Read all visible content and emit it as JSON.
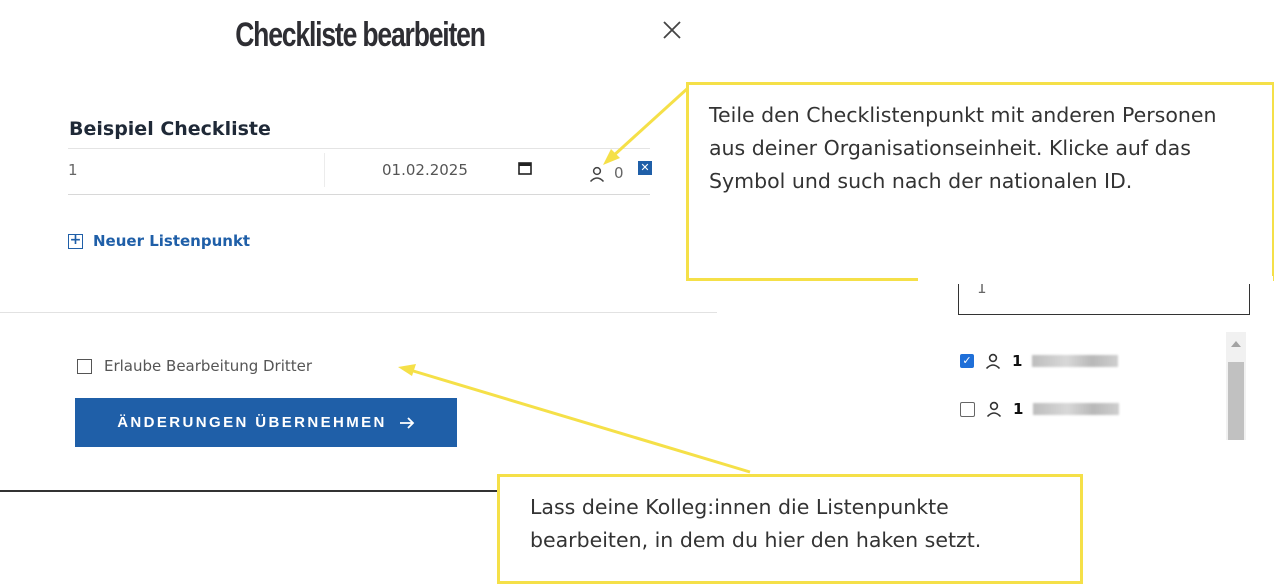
{
  "dialog": {
    "title": "Checkliste bearbeiten",
    "checklist_title": "Beispiel Checkliste",
    "item": {
      "text": "1",
      "date": "01.02.2025",
      "share_count": "0",
      "remove_icon": "x-square-icon"
    },
    "add_item_label": "Neuer Listenpunkt",
    "allow_third_party_label": "Erlaube Bearbeitung Dritter",
    "allow_third_party_checked": false,
    "apply_button_label": "ÄNDERUNGEN ÜBERNEHMEN"
  },
  "share_panel": {
    "search_value": "1",
    "results": [
      {
        "checked": true,
        "name_visible": "1"
      },
      {
        "checked": false,
        "name_visible": "1"
      }
    ]
  },
  "annotations": {
    "share_hint": "Teile den Checklistenpunkt mit anderen Personen aus deiner Organisationseinheit. Klicke auf das Symbol und such nach der nationalen ID.",
    "edit_hint": "Lass deine Kolleg:innen die Listenpunkte bearbeiten, in dem du hier den haken setzt."
  },
  "colors": {
    "primary": "#1f5fa8",
    "highlight": "#f5e048",
    "checkbox_checked": "#1f6fd8"
  },
  "icons": [
    "close-icon",
    "calendar-icon",
    "person-icon",
    "plus-box-icon",
    "arrow-right-icon",
    "x-square-icon"
  ]
}
